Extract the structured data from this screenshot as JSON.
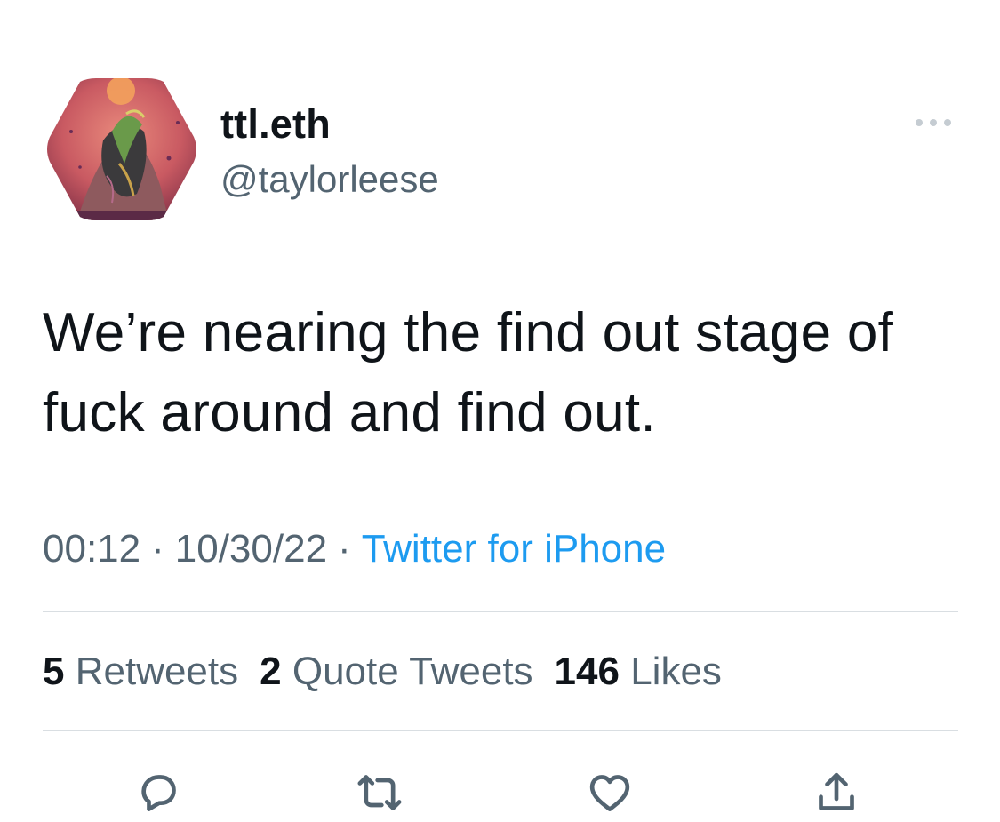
{
  "author": {
    "display_name": "ttl.eth",
    "handle": "@taylorleese"
  },
  "tweet": {
    "text": "We’re nearing the find out stage of fuck around and find out."
  },
  "meta": {
    "time": "00:12",
    "date": "10/30/22",
    "separator": "·",
    "source": "Twitter for iPhone"
  },
  "stats": {
    "retweets_count": "5",
    "retweets_label": "Retweets",
    "quotes_count": "2",
    "quotes_label": "Quote Tweets",
    "likes_count": "146",
    "likes_label": "Likes"
  },
  "icons": {
    "more": "more-horizontal-icon",
    "reply": "reply-icon",
    "retweet": "retweet-icon",
    "like": "heart-icon",
    "share": "share-icon"
  },
  "colors": {
    "text_primary": "#0f1419",
    "text_secondary": "#536471",
    "link": "#1d9bf0",
    "divider": "#d9dee2"
  }
}
